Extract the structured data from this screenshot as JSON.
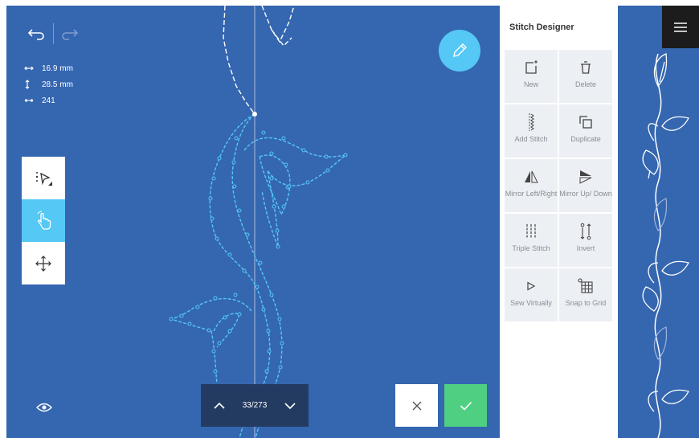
{
  "canvas": {
    "undo_icon": "undo-icon",
    "redo_icon": "redo-icon",
    "width_value": "16.9 mm",
    "height_value": "28.5 mm",
    "stitch_count": "241",
    "colors": {
      "background": "#3566b0",
      "stitch": "#55c8f5",
      "accent": "#55c8f5"
    }
  },
  "tools": [
    {
      "name": "select",
      "icon": "select-arrow-icon"
    },
    {
      "name": "touch",
      "icon": "hand-pointer-icon",
      "active": true
    },
    {
      "name": "move",
      "icon": "move-arrows-icon"
    }
  ],
  "navigator": {
    "counter": "33/273"
  },
  "actions": {
    "cancel_icon": "close-icon",
    "confirm_icon": "check-icon",
    "confirm_color": "#4fcf82"
  },
  "sidebar": {
    "title": "Stitch Designer",
    "items": [
      {
        "label": "New",
        "icon": "new-icon"
      },
      {
        "label": "Delete",
        "icon": "trash-icon"
      },
      {
        "label": "Add Stitch",
        "icon": "add-stitch-icon"
      },
      {
        "label": "Duplicate",
        "icon": "duplicate-icon"
      },
      {
        "label": "Mirror Left/Right",
        "icon": "mirror-left-right-icon"
      },
      {
        "label": "Mirror Up/ Down",
        "icon": "mirror-up-down-icon"
      },
      {
        "label": "Triple Stitch",
        "icon": "triple-stitch-icon"
      },
      {
        "label": "Invert",
        "icon": "invert-icon"
      },
      {
        "label": "Sew Virtually",
        "icon": "play-icon"
      },
      {
        "label": "Snap to Grid",
        "icon": "snap-grid-icon"
      }
    ]
  }
}
